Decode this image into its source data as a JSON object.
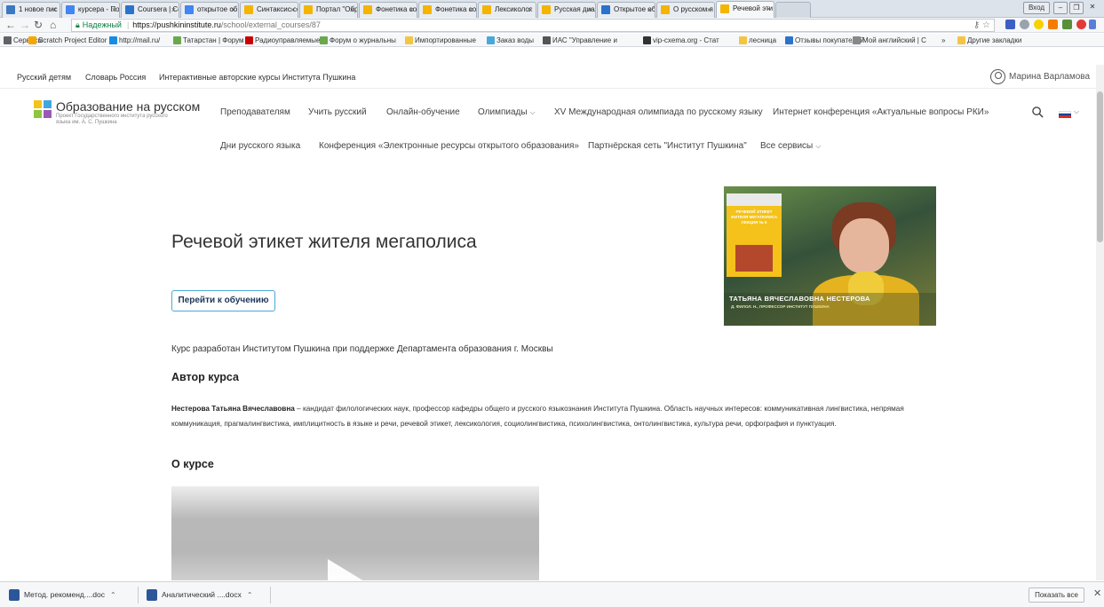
{
  "browser": {
    "tabs": [
      {
        "title": "1 новое пис",
        "favicon_color": "#3a78c2"
      },
      {
        "title": "курсера - По",
        "favicon_color": "#4285f4"
      },
      {
        "title": "Coursera | Сс",
        "favicon_color": "#2a73cc"
      },
      {
        "title": "открытое об",
        "favicon_color": "#4285f4"
      },
      {
        "title": "Синтаксис со",
        "favicon_color": "#f4b400"
      },
      {
        "title": "Портал \"Обр",
        "favicon_color": "#f4b400"
      },
      {
        "title": "Фонетика со",
        "favicon_color": "#f4b400"
      },
      {
        "title": "Фонетика со",
        "favicon_color": "#f4b400"
      },
      {
        "title": "Лексиколог",
        "favicon_color": "#f4b400"
      },
      {
        "title": "Русская диал",
        "favicon_color": "#f4b400"
      },
      {
        "title": "Открытое об",
        "favicon_color": "#2a73cc"
      },
      {
        "title": "О русском я",
        "favicon_color": "#f4b400"
      },
      {
        "title": "Речевой эти",
        "favicon_color": "#f4b400"
      }
    ],
    "window_label": "Вход",
    "omnibox": {
      "secure_label": "Надежный",
      "host": "https://pushkininstitute.ru",
      "path": "/school/external_courses/87"
    },
    "bookmarks": [
      {
        "label": "Сервисы",
        "color": "#5f6368"
      },
      {
        "label": "Scratch Project Editor",
        "color": "#f7a600"
      },
      {
        "label": "http://mail.ru/",
        "color": "#168de2"
      },
      {
        "label": "Татарстан | Форум и",
        "color": "#6aa84f"
      },
      {
        "label": "Радиоуправляемые",
        "color": "#cc0000"
      },
      {
        "label": "Форум о журнальны",
        "color": "#6aa84f"
      },
      {
        "label": "Импортированные",
        "color": "#f4c542"
      },
      {
        "label": "Заказ воды",
        "color": "#4aa8d8"
      },
      {
        "label": "ИАС \"Управление и",
        "color": "#555555"
      },
      {
        "label": "vip-cxema.org - Стат",
        "color": "#333333"
      },
      {
        "label": "лесница",
        "color": "#f4c542"
      },
      {
        "label": "Отзывы покупателей",
        "color": "#2a73cc"
      },
      {
        "label": "Мой английский | С",
        "color": "#888888"
      }
    ],
    "bookmarks_more": "»",
    "bookmarks_other": "Другие закладки"
  },
  "site": {
    "top_links": [
      "Русский детям",
      "Словарь Россия",
      "Интерактивные авторские курсы Института Пушкина"
    ],
    "user_name": "Марина Варламова",
    "brand": {
      "title": "Образование на русском",
      "subtitle": "Проект Государственного института русского языка им. А. С. Пушкина",
      "colors": [
        "#f4c21a",
        "#3fa7df",
        "#8dc63f",
        "#9b59b6"
      ]
    },
    "nav_row1": [
      {
        "label": "Преподавателям",
        "caret": ""
      },
      {
        "label": "Учить русский",
        "caret": ""
      },
      {
        "label": "Онлайн-обучение",
        "caret": ""
      },
      {
        "label": "Олимпиады",
        "caret": "⌵"
      },
      {
        "label": "XV Международная олимпиада по русскому языку",
        "caret": ""
      },
      {
        "label": "Интернет конференция «Актуальные вопросы РКИ»",
        "caret": ""
      }
    ],
    "nav_row2": [
      {
        "label": "Дни русского языка",
        "caret": ""
      },
      {
        "label": "Конференция «Электронные ресурсы открытого образования»",
        "caret": ""
      },
      {
        "label": "Партнёрская сеть \"Институт Пушкина\"",
        "caret": ""
      },
      {
        "label": "Все сервисы",
        "caret": "⌵"
      }
    ],
    "flag_colors": [
      "#ffffff",
      "#1c3f94",
      "#d52b1e"
    ]
  },
  "course": {
    "title": "Речевой этикет жителя мегаполиса",
    "cta": "Перейти к обучению",
    "thumbnail": {
      "board_title": "РЕЧЕВОЙ ЭТИКЕТ ЖИТЕЛЯ МЕГАПОЛИСА ЛЕКЦИЯ № 5",
      "name": "ТАТЬЯНА ВЯЧЕСЛАВОВНА НЕСТЕРОВА",
      "role": "Д. ФИЛОЛ. Н., ПРОФЕССОР ИНСТИТУТ ПУШКИНА"
    },
    "developed_by": "Курс разработан Институтом Пушкина при поддержке Департамента образования г. Москвы",
    "author_heading": "Автор  курса",
    "author_name": "Нестерова Татьяна Вячеславовна",
    "author_bio": " – кандидат филологических наук, профессор кафедры общего и русского языкознания Института Пушкина. Область научных интересов: коммуникативная лингвистика, непрямая коммуникация, прагмалингвистика, имплицитность в языке и речи, речевой этикет, лексикология, социолингвистика, психолингвистика, онтолингвистика, культура речи, орфография и пунктуация.",
    "about_heading": "О курсе"
  },
  "downloads": {
    "items": [
      {
        "name": "Метод. рекоменд....doc",
        "color": "#2b579a"
      },
      {
        "name": "Аналитический ....docx",
        "color": "#2b579a"
      }
    ],
    "show_all": "Показать все"
  }
}
